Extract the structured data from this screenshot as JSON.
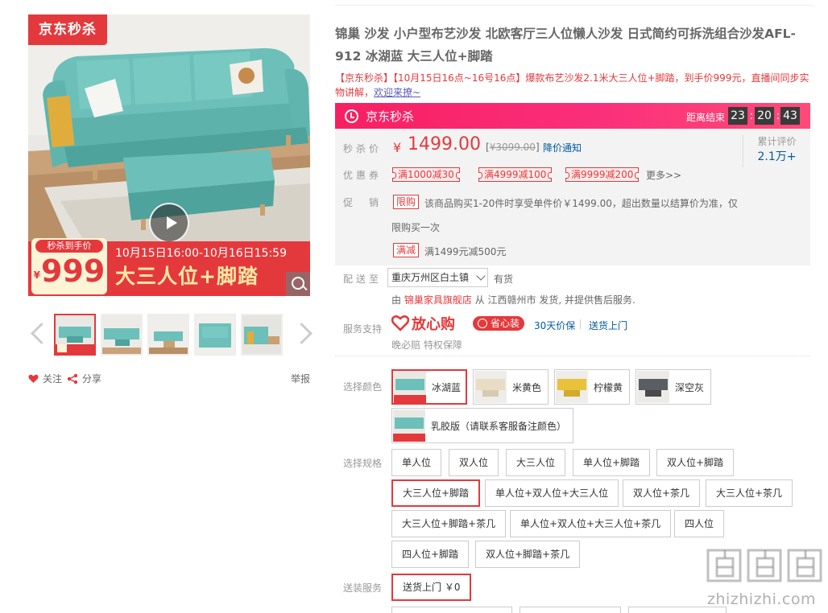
{
  "gallery": {
    "badge": "京东秒杀",
    "promo_label": "秒杀到手价",
    "promo_currency": "¥",
    "promo_price": "999",
    "promo_date": "10月15日16:00-10月16日15:59",
    "promo_title": "大三人位+脚踏"
  },
  "left_actions": {
    "follow": "关注",
    "share": "分享",
    "report": "举报"
  },
  "product": {
    "title": "锦巢 沙发 小户型布艺沙发 北欧客厅三人位懒人沙发 日式简约可拆洗组合沙发AFL-912 冰湖蓝 大三人位+脚踏",
    "subtitle": "【京东秒杀】【10月15日16点~16号16点】爆款布艺沙发2.1米大三人位+脚踏，到手价999元，直播间同步实物讲解，",
    "subtitle_link": "欢迎来撩~"
  },
  "seckill": {
    "name": "京东秒杀",
    "countdown_label": "距离结束",
    "hours": "23",
    "minutes": "20",
    "seconds": "43",
    "sep": ":"
  },
  "price": {
    "label": "秒杀价",
    "currency": "¥",
    "value": "1499.00",
    "original_prefix": "[",
    "original": "¥3099.00",
    "original_suffix": "]",
    "notify": "降价通知",
    "eval_label": "累计评价",
    "eval_count": "2.1万+"
  },
  "coupons": {
    "label": "优惠券",
    "items": [
      "满1000减30",
      "满4999减100",
      "满9999减200"
    ],
    "more": "更多>>"
  },
  "promotion": {
    "label": "促　销",
    "tag1": "限购",
    "text1a": "该商品购买1-20件时享受单件价￥1499.00，超出数量以结算价为准，仅",
    "text1b": "限购买一次",
    "tag2": "满减",
    "text2": "满1499元减500元"
  },
  "delivery": {
    "label": "配送至",
    "region": "重庆万州区白土镇",
    "stock": "有货",
    "from_prefix": "由",
    "shop": "锦巢家具旗舰店",
    "from_suffix": "从 江西赣州市 发货, 并提供售后服务."
  },
  "service": {
    "label": "服务支持",
    "fxg": "放心购",
    "sxz": "省心装",
    "price_protect": "30天价保",
    "delivery_up": "送货上门",
    "sub": "晚必赔  特权保障"
  },
  "colors": {
    "label": "选择颜色",
    "items": [
      "冰湖蓝",
      "米黄色",
      "柠檬黄",
      "深空灰",
      "乳胶版（请联系客服备注颜色）"
    ],
    "swatches": [
      "#6cc0b9",
      "#e8dcc4",
      "#e8c23a",
      "#5a5d62",
      "#6cc0b9"
    ]
  },
  "specs": {
    "label": "选择规格",
    "items": [
      "单人位",
      "双人位",
      "大三人位",
      "单人位+脚踏",
      "双人位+脚踏",
      "大三人位+脚踏",
      "单人位+双人位+大三人位",
      "双人位+茶几",
      "大三人位+茶几",
      "大三人位+脚踏+茶几",
      "单人位+双人位+大三人位+茶几",
      "四人位",
      "四人位+脚踏",
      "双人位+脚踏+茶几"
    ]
  },
  "install": {
    "label": "送装服务",
    "option": "送货上门 ￥0"
  },
  "watermark": {
    "text": "zhizhizhi.com"
  },
  "theme": {
    "accent": "#e4393c",
    "link": "#005aa0",
    "sofa": "#6cc0b9"
  }
}
